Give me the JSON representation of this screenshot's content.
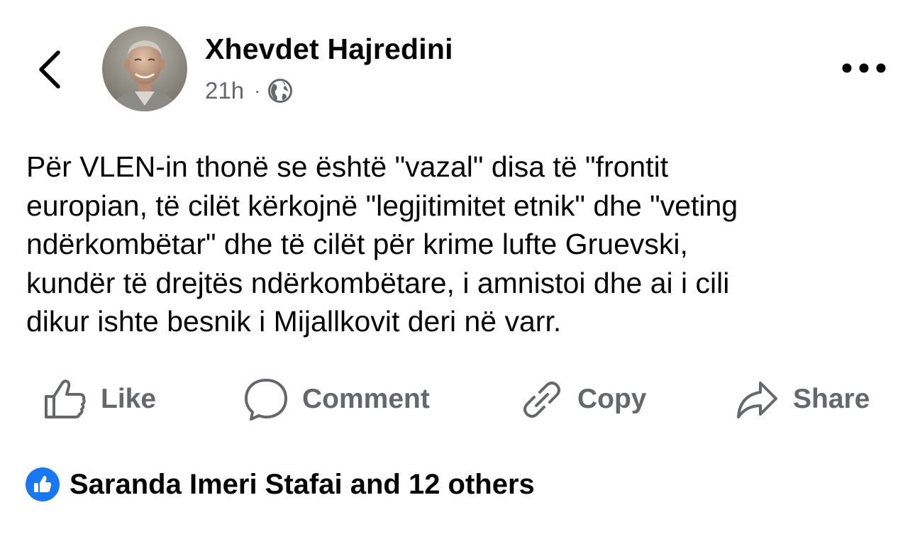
{
  "header": {
    "back_icon": "chevron-left-icon",
    "author_name": "Xhevdet Hajredini",
    "timestamp": "21h",
    "separator": "·",
    "audience_icon": "globe-icon",
    "more_icon": "more-horizontal-icon"
  },
  "post": {
    "lines": [
      "Për VLEN-in thonë se është \"vazal\" disa të \"frontit",
      "europian, të cilët kërkojnë \"legjitimitet etnik\" dhe \"veting",
      "ndërkombëtar\" dhe të cilët për krime lufte Gruevski,",
      "kundër të drejtës ndërkombëtare, i amnistoi dhe ai i cili",
      "dikur ishte besnik i Mijallkovit deri në varr."
    ]
  },
  "actions": {
    "like": "Like",
    "comment": "Comment",
    "copy": "Copy",
    "share": "Share"
  },
  "reactions": {
    "summary": "Saranda Imeri Stafai and 12 others",
    "icon": "like-reaction-icon",
    "badge_color": "#1877f2"
  },
  "colors": {
    "text": "#050505",
    "secondary": "#65676b",
    "accent": "#1877f2"
  }
}
